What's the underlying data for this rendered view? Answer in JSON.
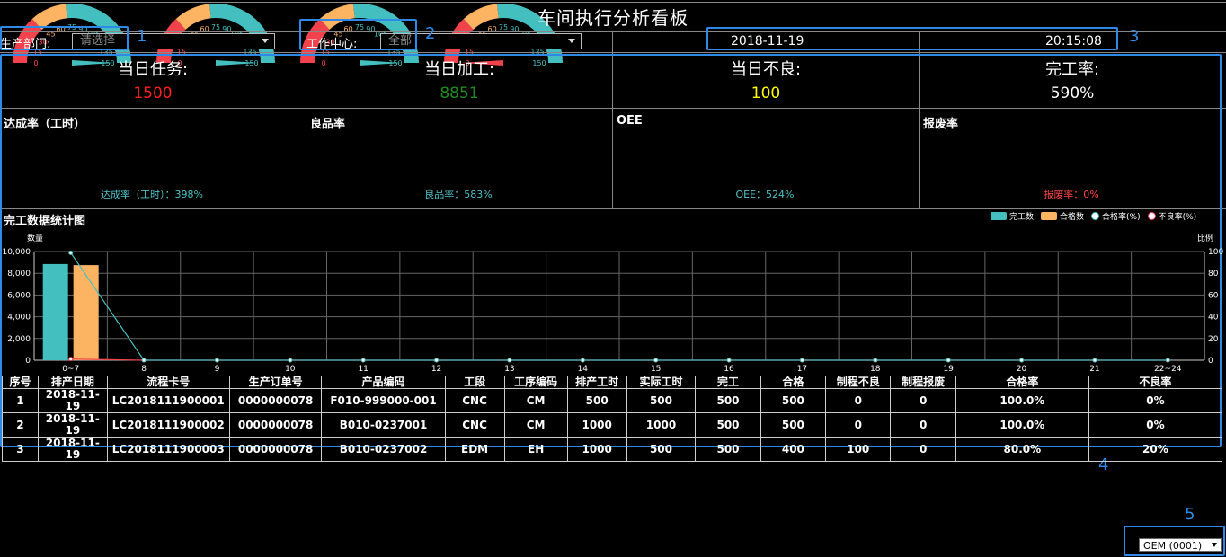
{
  "title": "车间执行分析看板",
  "filters": {
    "dept_label": "生产部门:",
    "dept_placeholder": "请选择",
    "center_label": "工作中心:",
    "center_value": "全部"
  },
  "date": "2018-11-19",
  "time": "20:15:08",
  "annotations": [
    "1",
    "2",
    "3",
    "4",
    "5"
  ],
  "kpis": [
    {
      "label": "当日任务:",
      "value": "1500",
      "color": "#ff2020"
    },
    {
      "label": "当日加工:",
      "value": "8851",
      "color": "#1f8a1f"
    },
    {
      "label": "当日不良:",
      "value": "100",
      "color": "#ffff00"
    },
    {
      "label": "完工率:",
      "value": "590%",
      "color": "#ffffff"
    }
  ],
  "gauges": [
    {
      "title": "达成率（工时）",
      "caption": "达成率（工时）：398%",
      "caption_color": "#4fc3c7",
      "value": 398
    },
    {
      "title": "良品率",
      "caption": "良品率：583%",
      "caption_color": "#4fc3c7",
      "value": 583
    },
    {
      "title": "OEE",
      "caption": "OEE：524%",
      "caption_color": "#4fc3c7",
      "value": 524
    },
    {
      "title": "报废率",
      "caption": "报废率：0%",
      "caption_color": "#ff4444",
      "value": 0
    }
  ],
  "gauge_ticks": [
    "0",
    "15",
    "30",
    "45",
    "60",
    "75",
    "90",
    "105",
    "120",
    "135",
    "150"
  ],
  "gauge_colors": {
    "low": "#f2434c",
    "mid": "#fdb462",
    "high": "#44bfc0"
  },
  "chart": {
    "title": "完工数据统计图",
    "ylabel_left": "数量",
    "ylabel_right": "比例",
    "legend": [
      "完工数",
      "合格数",
      "合格率(%)",
      "不良率(%)"
    ]
  },
  "chart_data": {
    "type": "bar",
    "categories": [
      "0~7",
      "8",
      "9",
      "10",
      "11",
      "12",
      "13",
      "14",
      "15",
      "16",
      "17",
      "18",
      "19",
      "20",
      "21",
      "22~24"
    ],
    "series": [
      {
        "name": "完工数",
        "type": "bar",
        "values": [
          8851,
          0,
          0,
          0,
          0,
          0,
          0,
          0,
          0,
          0,
          0,
          0,
          0,
          0,
          0,
          0
        ]
      },
      {
        "name": "合格数",
        "type": "bar",
        "values": [
          8751,
          0,
          0,
          0,
          0,
          0,
          0,
          0,
          0,
          0,
          0,
          0,
          0,
          0,
          0,
          0
        ]
      },
      {
        "name": "合格率(%)",
        "type": "line",
        "values": [
          98.9,
          0,
          0,
          0,
          0,
          0,
          0,
          0,
          0,
          0,
          0,
          0,
          0,
          0,
          0,
          0
        ]
      },
      {
        "name": "不良率(%)",
        "type": "line",
        "values": [
          1.1,
          0,
          0,
          0,
          0,
          0,
          0,
          0,
          0,
          0,
          0,
          0,
          0,
          0,
          0,
          0
        ]
      }
    ],
    "y_ticks_left": [
      "0",
      "2,000",
      "4,000",
      "6,000",
      "8,000",
      "10,000"
    ],
    "y_ticks_right": [
      "0",
      "20",
      "40",
      "60",
      "80",
      "100"
    ],
    "ylim_left": [
      0,
      10000
    ],
    "ylim_right": [
      0,
      100
    ],
    "colors": {
      "done": "#44bfc0",
      "good": "#fdb462",
      "passrate": "#44bfc0",
      "badrate": "#f2434c"
    }
  },
  "table": {
    "headers": [
      "序号",
      "排产日期",
      "流程卡号",
      "生产订单号",
      "产品编码",
      "工段",
      "工序编码",
      "排产工时",
      "实际工时",
      "完工",
      "合格",
      "制程不良",
      "制程报废",
      "合格率",
      "不良率"
    ],
    "rows": [
      [
        "1",
        "2018-11-19",
        "LC2018111900001",
        "0000000078",
        "F010-999000-001",
        "CNC",
        "CM",
        "500",
        "500",
        "500",
        "500",
        "0",
        "0",
        "100.0%",
        "0%"
      ],
      [
        "2",
        "2018-11-19",
        "LC2018111900002",
        "0000000078",
        "B010-0237001",
        "CNC",
        "CM",
        "1000",
        "1000",
        "500",
        "500",
        "0",
        "0",
        "100.0%",
        "0%"
      ],
      [
        "3",
        "2018-11-19",
        "LC2018111900003",
        "0000000078",
        "B010-0237002",
        "EDM",
        "EH",
        "1000",
        "500",
        "500",
        "400",
        "100",
        "0",
        "80.0%",
        "20%"
      ]
    ]
  },
  "footer_select": "OEM (0001)"
}
